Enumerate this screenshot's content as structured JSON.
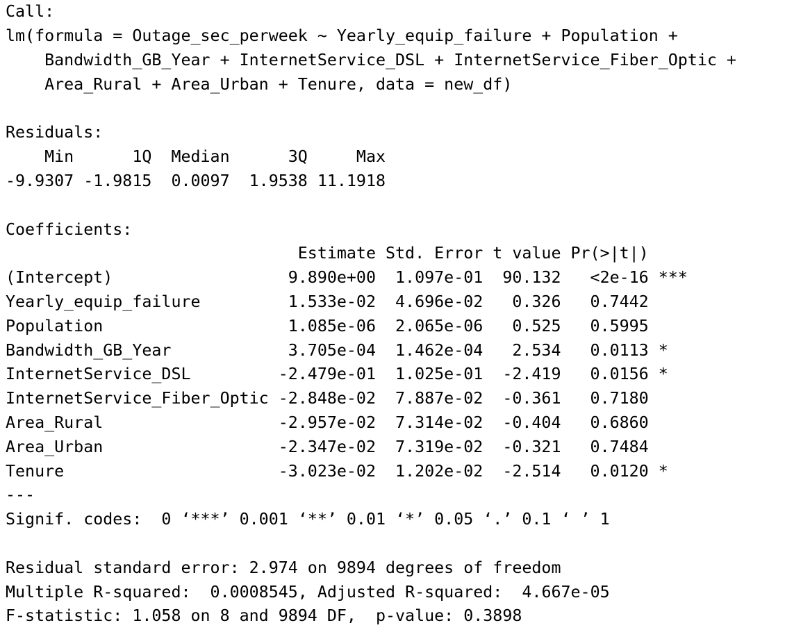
{
  "console": {
    "lines": [
      {
        "name": "call-header",
        "text": "Call:"
      },
      {
        "name": "call-formula-line",
        "text": "lm(formula = Outage_sec_perweek ~ Yearly_equip_failure + Population +"
      },
      {
        "name": "call-formula-line",
        "text": "    Bandwidth_GB_Year + InternetService_DSL + InternetService_Fiber_Optic +"
      },
      {
        "name": "call-formula-line",
        "text": "    Area_Rural + Area_Urban + Tenure, data = new_df)"
      },
      {
        "name": "blank-line",
        "text": ""
      },
      {
        "name": "residuals-header",
        "text": "Residuals:"
      },
      {
        "name": "residuals-column-headers",
        "text": "    Min      1Q  Median      3Q     Max "
      },
      {
        "name": "residuals-values",
        "text": "-9.9307 -1.9815  0.0097  1.9538 11.1918 "
      },
      {
        "name": "blank-line",
        "text": ""
      },
      {
        "name": "coefficients-header",
        "text": "Coefficients:"
      },
      {
        "name": "coefficients-column-headers",
        "text": "                              Estimate Std. Error t value Pr(>|t|)    "
      },
      {
        "name": "coefficient-row-intercept",
        "text": "(Intercept)                  9.890e+00  1.097e-01  90.132   <2e-16 ***"
      },
      {
        "name": "coefficient-row-yearly-equip-failure",
        "text": "Yearly_equip_failure         1.533e-02  4.696e-02   0.326   0.7442    "
      },
      {
        "name": "coefficient-row-population",
        "text": "Population                   1.085e-06  2.065e-06   0.525   0.5995    "
      },
      {
        "name": "coefficient-row-bandwidth",
        "text": "Bandwidth_GB_Year            3.705e-04  1.462e-04   2.534   0.0113 *  "
      },
      {
        "name": "coefficient-row-internetservice-dsl",
        "text": "InternetService_DSL         -2.479e-01  1.025e-01  -2.419   0.0156 *  "
      },
      {
        "name": "coefficient-row-internetservice-fiber",
        "text": "InternetService_Fiber_Optic -2.848e-02  7.887e-02  -0.361   0.7180    "
      },
      {
        "name": "coefficient-row-area-rural",
        "text": "Area_Rural                  -2.957e-02  7.314e-02  -0.404   0.6860    "
      },
      {
        "name": "coefficient-row-area-urban",
        "text": "Area_Urban                  -2.347e-02  7.319e-02  -0.321   0.7484    "
      },
      {
        "name": "coefficient-row-tenure",
        "text": "Tenure                      -3.023e-02  1.202e-02  -2.514   0.0120 *  "
      },
      {
        "name": "separator-line",
        "text": "---"
      },
      {
        "name": "signif-codes",
        "text": "Signif. codes:  0 ‘***’ 0.001 ‘**’ 0.01 ‘*’ 0.05 ‘.’ 0.1 ‘ ’ 1"
      },
      {
        "name": "blank-line",
        "text": ""
      },
      {
        "name": "residual-standard-error",
        "text": "Residual standard error: 2.974 on 9894 degrees of freedom"
      },
      {
        "name": "r-squared",
        "text": "Multiple R-squared:  0.0008545,\tAdjusted R-squared:  4.667e-05 "
      },
      {
        "name": "f-statistic",
        "text": "F-statistic: 1.058 on 8 and 9894 DF,  p-value: 0.3898"
      }
    ]
  }
}
